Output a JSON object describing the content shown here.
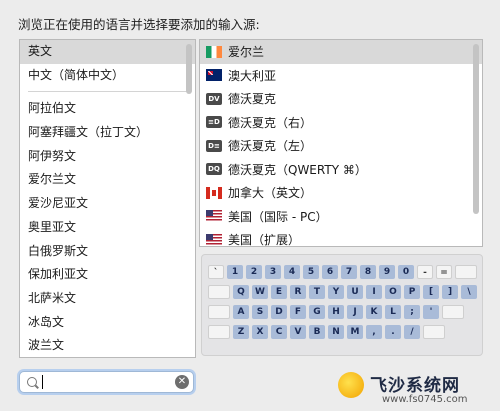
{
  "prompt": "浏览正在使用的语言并选择要添加的输入源:",
  "languages": {
    "pinned": [
      {
        "label": "英文",
        "selected": true
      },
      {
        "label": "中文（简体中文）",
        "selected": false
      }
    ],
    "items": [
      "阿拉伯文",
      "阿塞拜疆文（拉丁文）",
      "阿伊努文",
      "爱尔兰文",
      "爱沙尼亚文",
      "奥里亚文",
      "白俄罗斯文",
      "保加利亚文",
      "北萨米文",
      "冰岛文",
      "波兰文"
    ]
  },
  "sources": [
    {
      "label": "爱尔兰",
      "icon": "flag-ireland-icon",
      "selected": true
    },
    {
      "label": "澳大利亚",
      "icon": "flag-australia-icon",
      "selected": false
    },
    {
      "label": "德沃夏克",
      "icon": "dv-icon",
      "icon_text": "DV",
      "selected": false
    },
    {
      "label": "德沃夏克（右）",
      "icon": "dv-right-icon",
      "icon_text": "≡D",
      "selected": false
    },
    {
      "label": "德沃夏克（左）",
      "icon": "dv-left-icon",
      "icon_text": "D≡",
      "selected": false
    },
    {
      "label": "德沃夏克（QWERTY ⌘）",
      "icon": "dq-icon",
      "icon_text": "DQ",
      "selected": false
    },
    {
      "label": "加拿大（英文）",
      "icon": "flag-canada-icon",
      "selected": false
    },
    {
      "label": "美国（国际 - PC）",
      "icon": "flag-usa-icon",
      "selected": false
    },
    {
      "label": "美国（扩展）",
      "icon": "flag-usa-icon",
      "selected": false
    }
  ],
  "keyboard": {
    "row1": [
      "`",
      "1",
      "2",
      "3",
      "4",
      "5",
      "6",
      "7",
      "8",
      "9",
      "0",
      "-",
      "="
    ],
    "row2": [
      "Q",
      "W",
      "E",
      "R",
      "T",
      "Y",
      "U",
      "I",
      "O",
      "P",
      "[",
      "]",
      "\\"
    ],
    "row3": [
      "A",
      "S",
      "D",
      "F",
      "G",
      "H",
      "J",
      "K",
      "L",
      ";",
      "'"
    ],
    "row4": [
      "Z",
      "X",
      "C",
      "V",
      "B",
      "N",
      "M",
      ",",
      ".",
      "/"
    ]
  },
  "search": {
    "value": "",
    "placeholder": ""
  },
  "watermark": {
    "title": "飞沙系统网",
    "url": "www.fs0745.com"
  }
}
